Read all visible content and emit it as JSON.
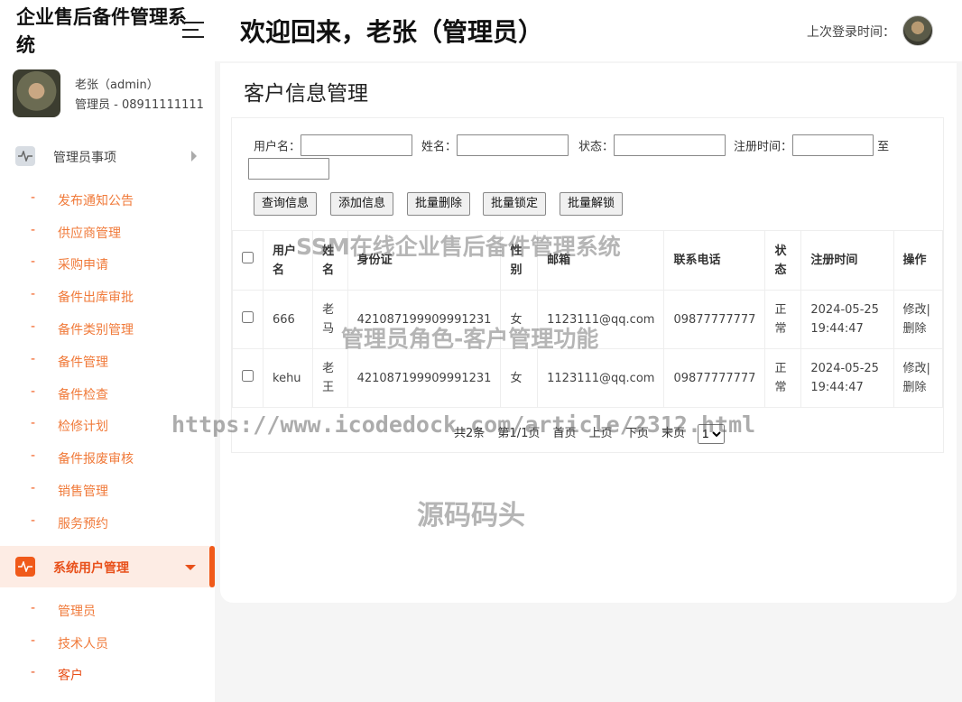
{
  "header": {
    "brand": "企业售后备件管理系统",
    "welcome": "欢迎回来，老张（管理员）",
    "last_login_label": "上次登录时间："
  },
  "profile": {
    "name": "老张（admin）",
    "role": "管理员 - 08911111111"
  },
  "sidebar": {
    "group1": {
      "label": "管理员事项",
      "items": [
        "发布通知公告",
        "供应商管理",
        "采购申请",
        "备件出库审批",
        "备件类别管理",
        "备件管理",
        "备件检查",
        "检修计划",
        "备件报废审核",
        "销售管理",
        "服务预约"
      ]
    },
    "group2": {
      "label": "系统用户管理",
      "items": [
        "管理员",
        "技术人员",
        "客户"
      ],
      "active_item": "客户"
    }
  },
  "main": {
    "title": "客户信息管理",
    "search": {
      "username_label": "用户名：",
      "name_label": "姓名：",
      "status_label": "状态：",
      "regtime_label": "注册时间：",
      "to_label": "至"
    },
    "buttons": {
      "query": "查询信息",
      "add": "添加信息",
      "batch_delete": "批量删除",
      "batch_lock": "批量锁定",
      "batch_unlock": "批量解锁"
    },
    "table": {
      "headers": [
        "用户名",
        "姓名",
        "身份证",
        "性别",
        "邮箱",
        "联系电话",
        "状态",
        "注册时间",
        "操作"
      ],
      "rows": [
        {
          "username": "666",
          "name": "老马",
          "id_card": "421087199909991231",
          "gender": "女",
          "email": "1123111@qq.com",
          "phone": "09877777777",
          "status": "正常",
          "reg_time": "2024-05-25 19:44:47",
          "edit": "修改",
          "sep": "|",
          "delete": "删除"
        },
        {
          "username": "kehu",
          "name": "老王",
          "id_card": "421087199909991231",
          "gender": "女",
          "email": "1123111@qq.com",
          "phone": "09877777777",
          "status": "正常",
          "reg_time": "2024-05-25 19:44:47",
          "edit": "修改",
          "sep": "|",
          "delete": "删除"
        }
      ]
    },
    "pager": {
      "total": "共2条",
      "page_info": "第1/1页",
      "first": "首页",
      "prev": "上页",
      "next": "下页",
      "last": "末页",
      "page_select": "1"
    }
  },
  "watermarks": {
    "w1": "SSM在线企业售后备件管理系统",
    "w2": "管理员角色-客户管理功能",
    "w3": "https://www.icodedock.com/article/2312.html",
    "w4": "源码码头"
  },
  "colors": {
    "accent": "#f05a1a",
    "accent_bg": "#fdece4",
    "menu_text": "#f07a3a"
  }
}
